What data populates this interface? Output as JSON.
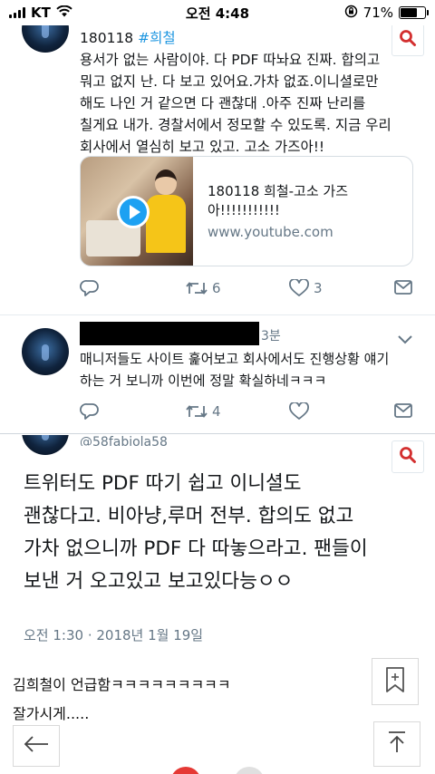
{
  "status_bar": {
    "carrier": "KT",
    "time": "오전 4:48",
    "battery_percent": "71%",
    "battery_level": 0.71
  },
  "tweet1": {
    "date": "180118",
    "hashtag": "#희철",
    "body": "용서가 없는 사람이야. 다 PDF 따놔요 진짜. 합의고\n뭐고 없지 난. 다 보고 있어요.가차 없죠.이니셜로만\n해도 나인 거 같으면 다 괜찮대 .아주 진짜 난리를\n칠게요 내가. 경찰서에서 정모할 수 있도록. 지금 우리\n회사에서 열심히 보고 있고. 고소 가즈아!!",
    "card": {
      "title": "180118 희철-고소 가즈아!!!!!!!!!!!",
      "domain": "www.youtube.com"
    },
    "retweets": "6",
    "likes": "3"
  },
  "tweet2": {
    "time": "3분",
    "body": "매니저들도 사이트 훑어보고 회사에서도 진행상황 얘기하는 거 보니까 이번에 정말 확실하네ㅋㅋㅋ",
    "retweets": "4"
  },
  "quoted_tweet": {
    "handle": "@58fabiola58",
    "body": "트위터도 PDF 따기 쉽고 이니셜도\n괜찮다고. 비아냥,루머 전부. 합의도 없고\n가차 없으니까 PDF 다 따놓으라고. 팬들이\n보낸 거 오고있고 보고있다능ㅇㅇ",
    "timestamp": "오전 1:30 · 2018년 1월 19일"
  },
  "post_text": "김희철이 언급함ㅋㅋㅋㅋㅋㅋㅋㅋㅋ\n잘가시게.....",
  "colors": {
    "link": "#1b95e0",
    "muted": "#657786",
    "search_icon": "#d32f2f",
    "play_button": "#1da1f2"
  },
  "icons": [
    "signal-icon",
    "wifi-icon",
    "lock-rotation-icon",
    "battery-icon",
    "search-icon",
    "reply-icon",
    "retweet-icon",
    "like-icon",
    "message-icon",
    "chevron-down-icon",
    "bookmark-add-icon",
    "back-arrow-icon",
    "scroll-top-icon",
    "play-icon"
  ]
}
